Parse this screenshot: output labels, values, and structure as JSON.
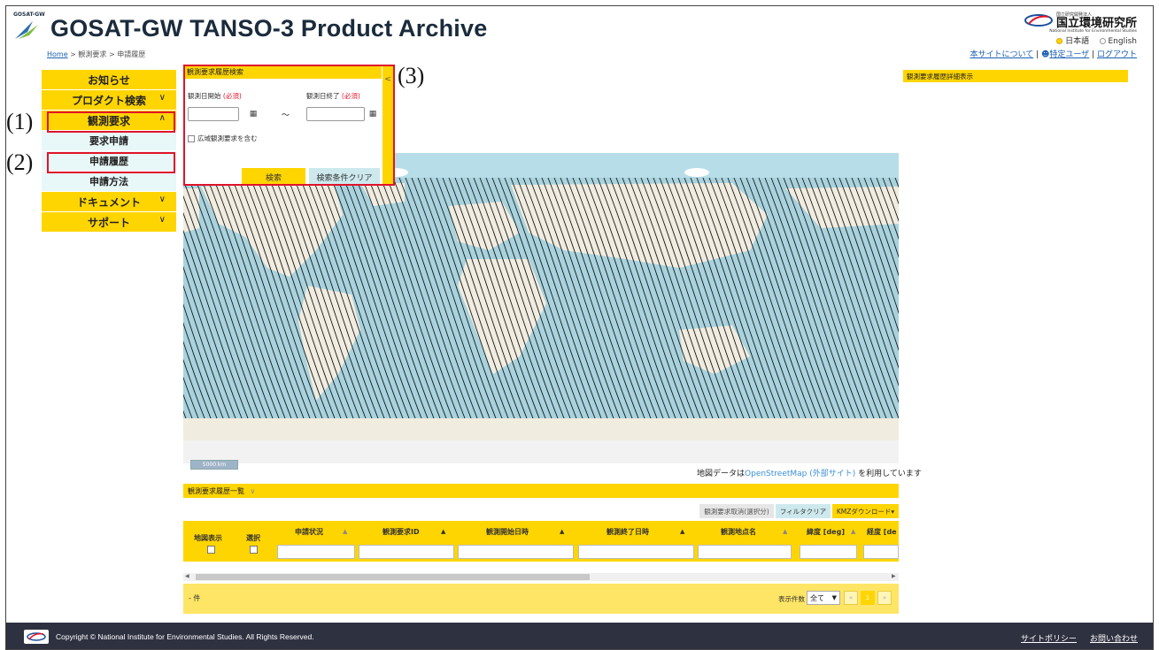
{
  "header": {
    "logo_text": "GOSAT-GW",
    "title": "GOSAT-GW TANSO-3 Product Archive",
    "breadcrumb": {
      "home": "Home",
      "sep1": ">",
      "level2": "観測要求",
      "sep2": ">",
      "current": "申請履歴"
    },
    "nies": {
      "small_jp": "国立研究開発法人",
      "name_jp": "国立環境研究所",
      "name_en": "National Institute for Environmental Studies"
    },
    "language": {
      "ja": "日本語",
      "en": "English",
      "selected": "ja"
    },
    "links": {
      "about": "本サイトについて",
      "user": "特定ユーザ",
      "logout": "ログアウト",
      "sep": "|"
    }
  },
  "sidebar": {
    "items": [
      {
        "label": "お知らせ",
        "chevron": ""
      },
      {
        "label": "プロダクト検索",
        "chevron": "∨"
      },
      {
        "label": "観測要求",
        "chevron": "∧"
      },
      {
        "label": "要求申請",
        "chevron": ""
      },
      {
        "label": "申請履歴",
        "chevron": ""
      },
      {
        "label": "申請方法",
        "chevron": ""
      },
      {
        "label": "ドキュメント",
        "chevron": "∨"
      },
      {
        "label": "サポート",
        "chevron": "∨"
      }
    ]
  },
  "annotations": {
    "a1": "(1)",
    "a2": "(2)",
    "a3": "(3)"
  },
  "search_panel": {
    "title": "観測要求履歴検索",
    "collapse_icon": "<",
    "start_label": "観測日開始",
    "end_label": "観測日終了",
    "required": "(必須)",
    "start_value": "",
    "end_value": "",
    "tilde": "～",
    "wide_area_label": "広域観測要求を含む",
    "search_button": "検索",
    "clear_button": "検索条件クリア"
  },
  "detail_panel": {
    "title": "観測要求履歴詳細表示"
  },
  "map": {
    "scale_text": "5000 km",
    "attribution_prefix": "地図データは",
    "attribution_link": "OpenStreetMap (外部サイト)",
    "attribution_suffix": " を利用しています"
  },
  "list": {
    "title": "観測要求履歴一覧",
    "title_chevron": "∨",
    "buttons": {
      "cancel": "観測要求取消(選択分)",
      "filter_clear": "フィルタクリア",
      "kmz": "KMZダウンロード▾"
    },
    "columns": [
      "地図表示",
      "選択",
      "申請状況",
      "観測要求ID",
      "観測開始日時",
      "観測終了日時",
      "観測地点名",
      "緯度 [deg]",
      "経度 [de"
    ],
    "count_text": "- 件",
    "page_size_label": "表示件数",
    "page_size_value": "全て",
    "pager": {
      "first": "«",
      "current": "1",
      "last": "»"
    }
  },
  "footer": {
    "copyright": "Copyright © National Institute for Environmental Studies. All Rights Reserved.",
    "policy": "サイトポリシー",
    "contact": "お問い合わせ"
  },
  "colors": {
    "accent": "#ffd500",
    "highlight": "#e0142b",
    "submenu": "#e8f7f7",
    "footer": "#2e3140",
    "ocean": "#a8d3de",
    "land": "#f1ece0"
  }
}
